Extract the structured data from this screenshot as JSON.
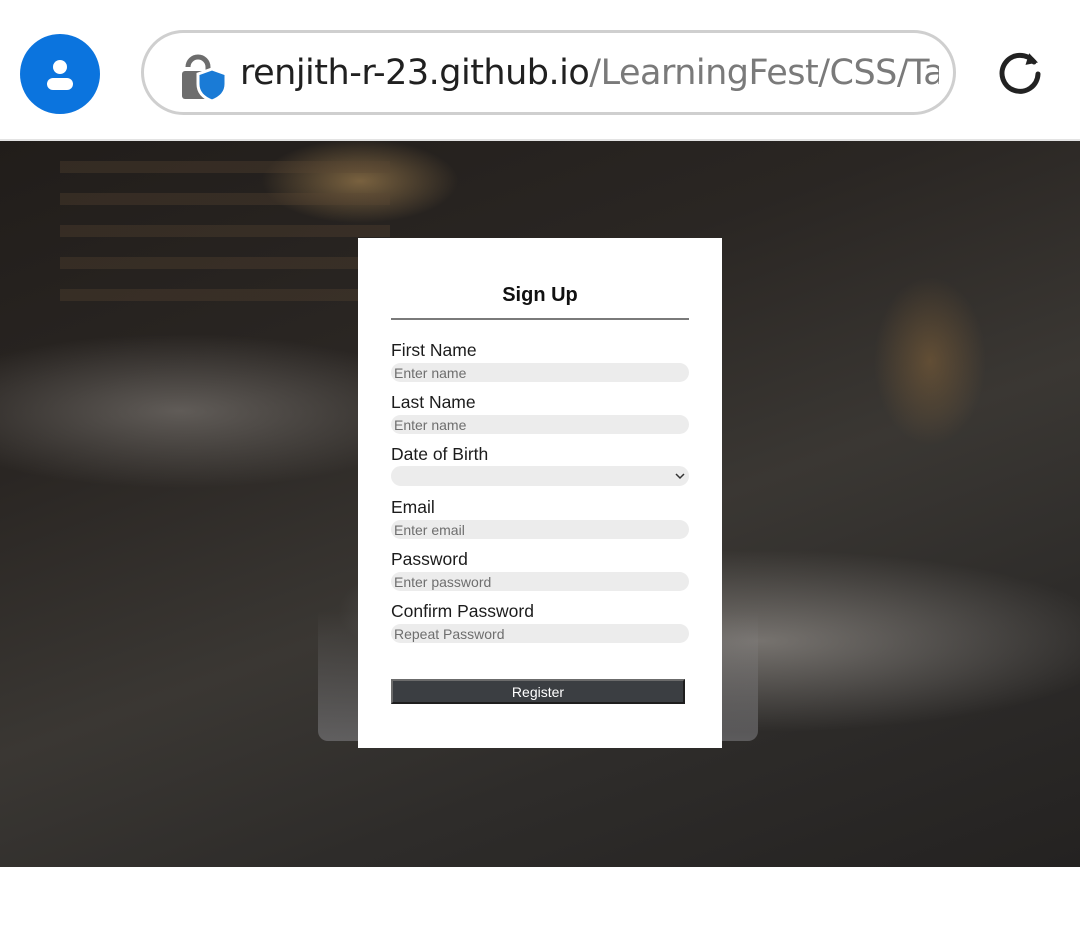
{
  "browser": {
    "url_host": "renjith-r-23.github.io",
    "url_path": "/LearningFest/CSS/Task",
    "profile_icon": "person-icon",
    "lock_icon": "lock-shield-icon",
    "reload_icon": "reload-icon",
    "accent_color": "#0b74de"
  },
  "form": {
    "title": "Sign Up",
    "fields": [
      {
        "label": "First Name",
        "placeholder": "Enter name"
      },
      {
        "label": "Last Name",
        "placeholder": "Enter name"
      },
      {
        "label": "Date of Birth",
        "placeholder": ""
      },
      {
        "label": "Email",
        "placeholder": "Enter email"
      },
      {
        "label": "Password",
        "placeholder": "Enter password"
      },
      {
        "label": "Confirm Password",
        "placeholder": "Repeat Password"
      }
    ],
    "register_label": "Register",
    "button_color": "#3b3e42"
  }
}
